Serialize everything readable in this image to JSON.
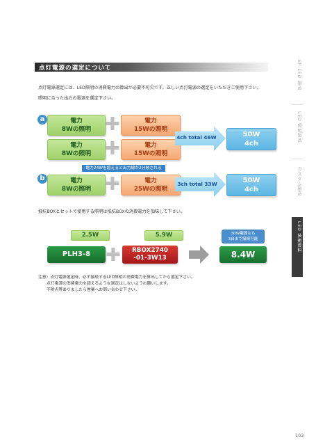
{
  "header": {
    "title": "点灯電源の選定について"
  },
  "intro": {
    "line1": "点灯電源選定には、LED照明の消費電力の算出が必要不可欠です。正しい点灯電源の選定をいただきご使用下さい。",
    "line2": "照明に合った出力の電源を選定下さい。"
  },
  "example_a": {
    "label": "a",
    "row1": {
      "green": {
        "line1": "電力",
        "line2": "8Wの照明"
      },
      "orange": {
        "line1": "電力",
        "line2": "15Wの照明"
      }
    },
    "row2": {
      "green": {
        "line1": "電力",
        "line2": "8Wの照明"
      },
      "orange": {
        "line1": "電力",
        "line2": "15Wの照明"
      }
    },
    "total": "4ch total 46W",
    "result": {
      "line1": "50W",
      "line2": "4ch"
    }
  },
  "banner": "電力24Wを超えると出力線が2分岐される",
  "example_b": {
    "label": "b",
    "green": {
      "line1": "電力",
      "line2": "8Wの照明"
    },
    "orange": {
      "line1": "電力",
      "line2": "25Wの照明"
    },
    "total": "3ch total 33W",
    "result": {
      "line1": "50W",
      "line2": "4ch"
    }
  },
  "resistor_note": "抵抗BOXとセットで使用する照明は抵抗BOXの消費電力を加味して下さい。",
  "example_c": {
    "cap1": "2.5W",
    "cap2": "5.9W",
    "item1": "PLH3-8",
    "item2": {
      "line1": "RBOX2740",
      "line2": "-01-3W13"
    },
    "note": {
      "line1": "30W電源なら",
      "line2": "3台まで接続可能"
    },
    "result": "8.4W"
  },
  "notes": {
    "line1": "注意）点灯電源選定時、必ず接続するLED照明の消費電力を算出してから選定下さい。",
    "line2": "点灯電源の消費電力を超えるような選定はしないようお願いします。",
    "line3": "不明点等ありましたら営業へお問い合わせ下さい。"
  },
  "side_tabs": {
    "tab1": "SP LED 製品",
    "tab2": "LED 照明製品",
    "tab3": "カスタム製品",
    "tab4": "LED 技術資料"
  },
  "page_number": "103",
  "colors": {
    "accent_blue": "#3a82c4",
    "green_light": "#a6d671",
    "orange_light": "#f5a873",
    "green_dark": "#177030",
    "red": "#a5161a"
  }
}
